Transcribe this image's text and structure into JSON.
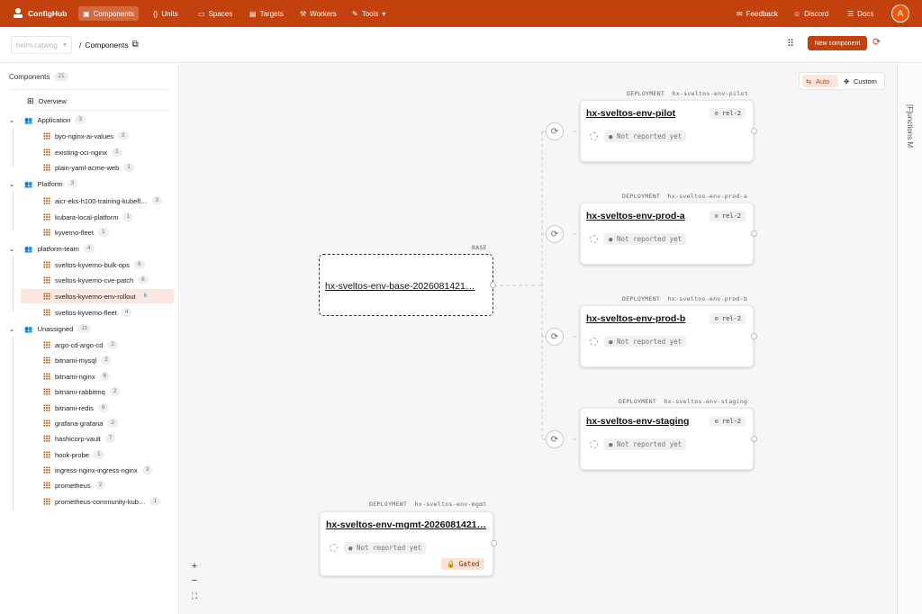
{
  "topbar": {
    "brand": "ConfigHub",
    "nav": [
      "Components",
      "Units",
      "Spaces",
      "Targets",
      "Workers",
      "Tools"
    ],
    "right": [
      "Feedback",
      "Discord",
      "Docs"
    ],
    "avatar": "A"
  },
  "header": {
    "app_select_placeholder": "helm-catalog",
    "breadcrumb_sep": "/",
    "breadcrumb_current": "Components",
    "new_button": "New component"
  },
  "sidebar": {
    "title": "Components",
    "count": "21",
    "overview": "Overview",
    "groups": [
      {
        "label": "Application",
        "count": "3",
        "items": [
          {
            "label": "byo-nginx-ai-values",
            "count": "3"
          },
          {
            "label": "existing-oci-nginx",
            "count": "1"
          },
          {
            "label": "plain-yaml-acme-web",
            "count": "1"
          }
        ]
      },
      {
        "label": "Platform",
        "count": "3",
        "items": [
          {
            "label": "aicr-eks-h100-training-kubefl…",
            "count": "3"
          },
          {
            "label": "kubara-local-platform",
            "count": "1"
          },
          {
            "label": "kyverno-fleet",
            "count": "1"
          }
        ]
      },
      {
        "label": "platform-team",
        "count": "4",
        "items": [
          {
            "label": "sveltos-kyverno-bulk-ops",
            "count": "6"
          },
          {
            "label": "sveltos-kyverno-cve-patch",
            "count": "6"
          },
          {
            "label": "sveltos-kyverno-env-rollout",
            "count": "6"
          },
          {
            "label": "sveltos-kyverno-fleet",
            "count": "4"
          }
        ]
      },
      {
        "label": "Unassigned",
        "count": "11",
        "items": [
          {
            "label": "argo-cd-argo-cd",
            "count": "2"
          },
          {
            "label": "bitnami-mysql",
            "count": "2"
          },
          {
            "label": "bitnami-nginx",
            "count": "6"
          },
          {
            "label": "bitnami-rabbitmq",
            "count": "2"
          },
          {
            "label": "bitnami-redis",
            "count": "6"
          },
          {
            "label": "grafana-grafana",
            "count": "2"
          },
          {
            "label": "hashicorp-vault",
            "count": "7"
          },
          {
            "label": "hook-probe",
            "count": "1"
          },
          {
            "label": "ingress-nginx-ingress-nginx",
            "count": "3"
          },
          {
            "label": "prometheus",
            "count": "2"
          },
          {
            "label": "prometheus-community-kub…",
            "count": "1"
          }
        ]
      }
    ]
  },
  "canvas": {
    "toggle": {
      "auto": "Auto",
      "custom": "Custom"
    },
    "right_panel": "[F]unctions M",
    "base": {
      "kind": "BASE",
      "name": "hx-sveltos-env-base-20260814​21…"
    },
    "deployments": [
      {
        "kind": "DEPLOYMENT",
        "slug": "hx-sveltos-env-pilot",
        "name": "hx-sveltos-env-pilot",
        "rel": "rel-2",
        "status": "● Not reported yet"
      },
      {
        "kind": "DEPLOYMENT",
        "slug": "hx-sveltos-env-prod-a",
        "name": "hx-sveltos-env-prod-a",
        "rel": "rel-2",
        "status": "● Not reported yet"
      },
      {
        "kind": "DEPLOYMENT",
        "slug": "hx-sveltos-env-prod-b",
        "name": "hx-sveltos-env-prod-b",
        "rel": "rel-2",
        "status": "● Not reported yet"
      },
      {
        "kind": "DEPLOYMENT",
        "slug": "hx-sveltos-env-staging",
        "name": "hx-sveltos-env-staging",
        "rel": "rel-2",
        "status": "● Not reported yet"
      }
    ],
    "mgmt": {
      "kind": "DEPLOYMENT",
      "slug": "hx-sveltos-env-mgmt",
      "name": "hx-sveltos-env-mgmt-20260814​21…",
      "status": "● Not reported yet",
      "gated": "🔒 Gated"
    },
    "zoom": [
      "+",
      "−",
      "⛶"
    ]
  }
}
